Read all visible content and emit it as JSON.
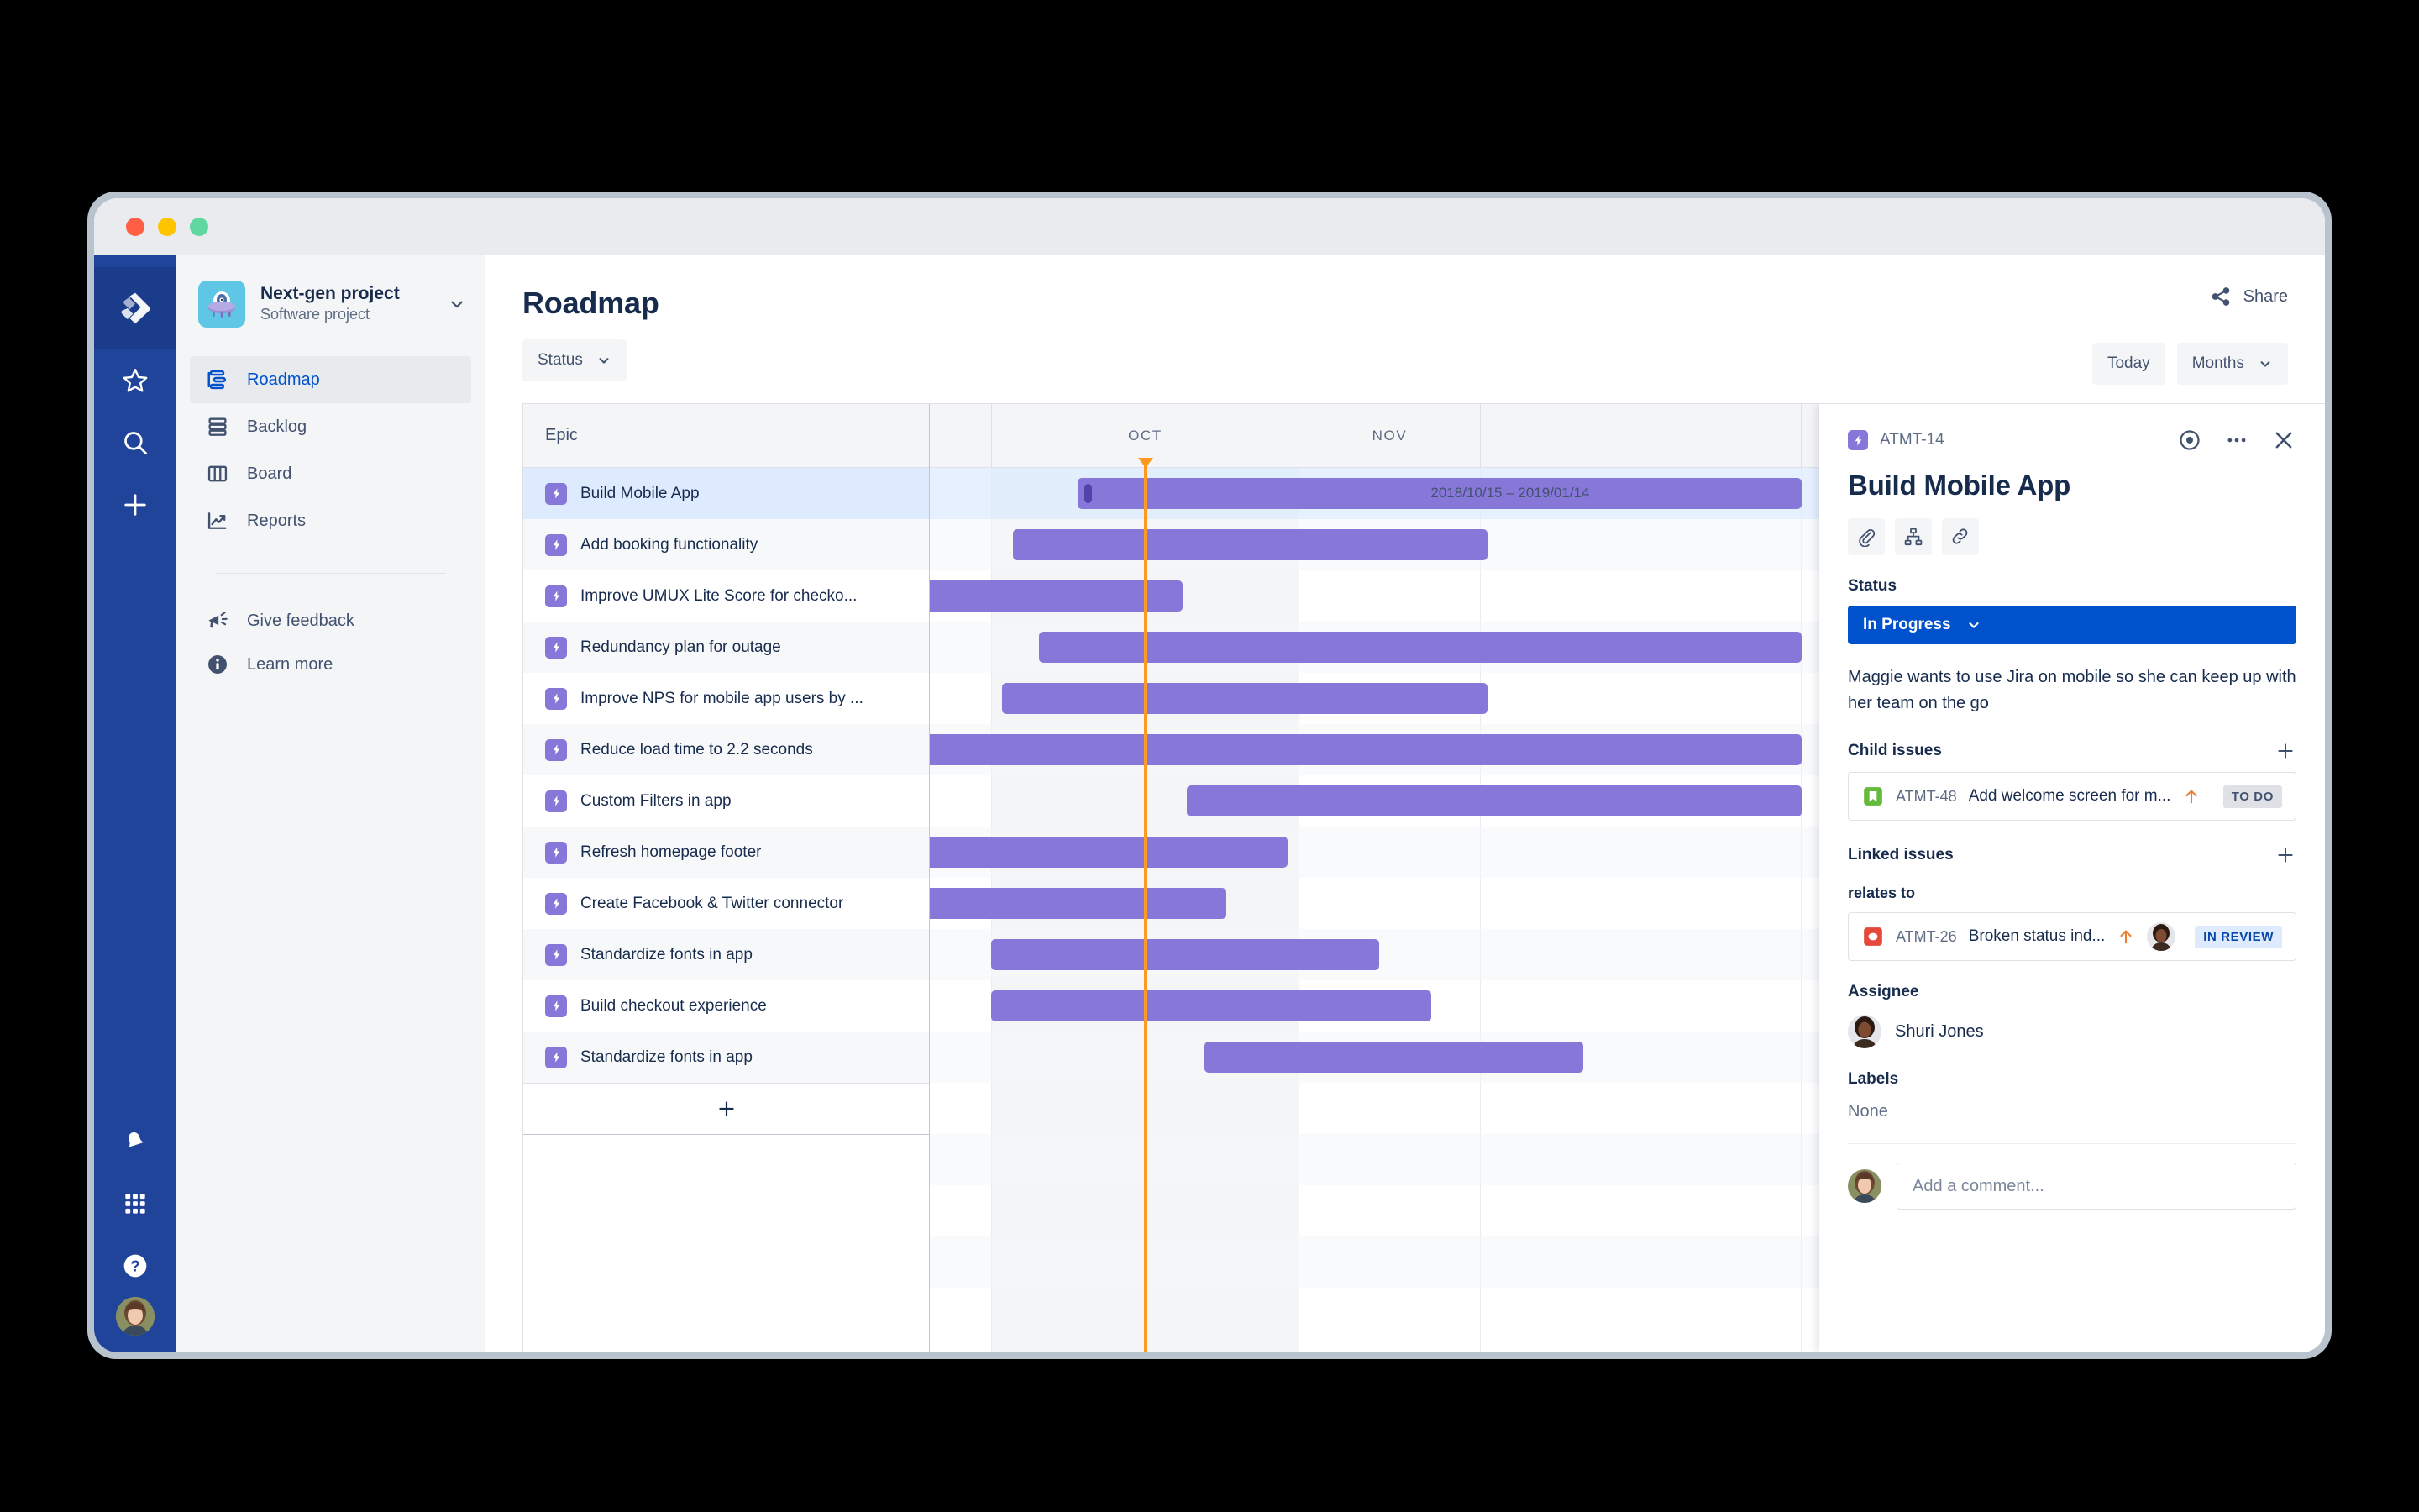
{
  "window": {
    "traffic_lights": [
      "close",
      "minimize",
      "maximize"
    ]
  },
  "rail": {
    "logo_icon": "jira-logo-icon",
    "items": [
      {
        "name": "starred",
        "icon": "star-icon"
      },
      {
        "name": "search",
        "icon": "search-icon"
      },
      {
        "name": "create",
        "icon": "plus-icon"
      }
    ],
    "bottom_items": [
      {
        "name": "notifications",
        "icon": "bell-icon"
      },
      {
        "name": "app-switcher",
        "icon": "grid-icon"
      },
      {
        "name": "help",
        "icon": "question-circle-icon"
      }
    ],
    "avatar": "user-avatar"
  },
  "sidebar": {
    "project": {
      "name": "Next-gen project",
      "type": "Software project",
      "avatar_icon": "ufo-project-icon",
      "caret_icon": "chevron-down-icon"
    },
    "items": [
      {
        "label": "Roadmap",
        "icon": "roadmap-icon",
        "active": true
      },
      {
        "label": "Backlog",
        "icon": "backlog-icon",
        "active": false
      },
      {
        "label": "Board",
        "icon": "board-icon",
        "active": false
      },
      {
        "label": "Reports",
        "icon": "reports-icon",
        "active": false
      }
    ],
    "footer_items": [
      {
        "label": "Give feedback",
        "icon": "megaphone-icon"
      },
      {
        "label": "Learn more",
        "icon": "info-icon"
      }
    ]
  },
  "header": {
    "title": "Roadmap",
    "status_filter": "Status",
    "status_filter_icon": "chevron-down-icon",
    "share_label": "Share",
    "share_icon": "share-icon",
    "today_label": "Today",
    "zoom_label": "Months",
    "zoom_icon": "chevron-down-icon"
  },
  "roadmap": {
    "column_header": "Epic",
    "add_epic_icon": "plus-icon",
    "months": [
      "",
      "OCT",
      "NOV",
      ""
    ],
    "today_marker": true,
    "selected_row_index": 0,
    "selected_bar_label": "2018/10/15 – 2019/01/14",
    "epics": [
      {
        "name": "Build Mobile App",
        "icon": "epic-icon"
      },
      {
        "name": "Add booking functionality",
        "icon": "epic-icon"
      },
      {
        "name": "Improve UMUX Lite Score for checko...",
        "icon": "epic-icon"
      },
      {
        "name": "Redundancy plan for outage",
        "icon": "epic-icon"
      },
      {
        "name": "Improve NPS for mobile app users by ...",
        "icon": "epic-icon"
      },
      {
        "name": "Reduce load time to 2.2 seconds",
        "icon": "epic-icon"
      },
      {
        "name": "Custom Filters in app",
        "icon": "epic-icon"
      },
      {
        "name": "Refresh homepage footer",
        "icon": "epic-icon"
      },
      {
        "name": "Create Facebook & Twitter connector",
        "icon": "epic-icon"
      },
      {
        "name": "Standardize fonts in app",
        "icon": "epic-icon"
      },
      {
        "name": "Build checkout experience",
        "icon": "epic-icon"
      },
      {
        "name": "Standardize fonts in app",
        "icon": "epic-icon"
      }
    ]
  },
  "chart_data": {
    "type": "bar",
    "title": "Roadmap",
    "xlabel": "",
    "ylabel": "",
    "grid": true,
    "legend": "none",
    "x_axis_ticks": [
      "OCT",
      "NOV"
    ],
    "x_range_pct": [
      0,
      100
    ],
    "today_pct": 24.6,
    "categories": [
      "Build Mobile App",
      "Add booking functionality",
      "Improve UMUX Lite Score for checko...",
      "Redundancy plan for outage",
      "Improve NPS for mobile app users by ...",
      "Reduce load time to 2.2 seconds",
      "Custom Filters in app",
      "Refresh homepage footer",
      "Create Facebook & Twitter connector",
      "Standardize fonts in app",
      "Build checkout experience",
      "Standardize fonts in app"
    ],
    "bars": [
      {
        "label": "Build Mobile App",
        "start_pct": 17.0,
        "end_pct": 100.0,
        "dates": "2018/10/15 – 2019/01/14",
        "handle": true
      },
      {
        "label": "Add booking functionality",
        "start_pct": 9.5,
        "end_pct": 64.0,
        "dates": "",
        "handle": false
      },
      {
        "label": "Improve UMUX Lite Score for checko...",
        "start_pct": -2.0,
        "end_pct": 29.0,
        "dates": "",
        "handle": false
      },
      {
        "label": "Redundancy plan for outage",
        "start_pct": 12.5,
        "end_pct": 100.0,
        "dates": "",
        "handle": false
      },
      {
        "label": "Improve NPS for mobile app users by ...",
        "start_pct": 8.3,
        "end_pct": 64.0,
        "dates": "",
        "handle": false
      },
      {
        "label": "Reduce load time to 2.2 seconds",
        "start_pct": -2.0,
        "end_pct": 100.0,
        "dates": "",
        "handle": false
      },
      {
        "label": "Custom Filters in app",
        "start_pct": 29.5,
        "end_pct": 100.0,
        "dates": "",
        "handle": false
      },
      {
        "label": "Refresh homepage footer",
        "start_pct": -2.0,
        "end_pct": 41.0,
        "dates": "",
        "handle": false
      },
      {
        "label": "Create Facebook & Twitter connector",
        "start_pct": -2.0,
        "end_pct": 34.0,
        "dates": "",
        "handle": false
      },
      {
        "label": "Standardize fonts in app",
        "start_pct": 7.0,
        "end_pct": 51.5,
        "dates": "",
        "handle": false
      },
      {
        "label": "Build checkout experience",
        "start_pct": 7.0,
        "end_pct": 57.5,
        "dates": "",
        "handle": false
      },
      {
        "label": "Standardize fonts in app",
        "start_pct": 31.5,
        "end_pct": 75.0,
        "dates": "",
        "handle": false
      }
    ],
    "bar_color": "#8777d9",
    "today_color": "#ff991f"
  },
  "detail": {
    "issue_key": "ATMT-14",
    "key_icon": "epic-icon",
    "watch_icon": "eye-icon",
    "more_icon": "more-horizontal-icon",
    "close_icon": "close-icon",
    "title": "Build Mobile App",
    "action_icons": [
      "attach-icon",
      "child-issue-icon",
      "link-icon"
    ],
    "status_label": "Status",
    "status_value": "In Progress",
    "status_caret_icon": "chevron-down-icon",
    "description": "Maggie wants to use Jira on mobile so she can keep up with her team on the go",
    "child_issues_label": "Child issues",
    "child_add_icon": "plus-icon",
    "child_issues": [
      {
        "key": "ATMT-48",
        "summary": "Add welcome screen for m...",
        "type_icon": "story-icon",
        "priority_icon": "priority-high-icon",
        "status": "TO DO",
        "status_style": "todo",
        "avatar": false
      }
    ],
    "linked_issues_label": "Linked issues",
    "linked_add_icon": "plus-icon",
    "relation_label": "relates to",
    "linked_issues": [
      {
        "key": "ATMT-26",
        "summary": "Broken status ind...",
        "type_icon": "bug-icon",
        "priority_icon": "priority-high-icon",
        "status": "IN REVIEW",
        "status_style": "review",
        "avatar": true
      }
    ],
    "assignee_label": "Assignee",
    "assignee_name": "Shuri Jones",
    "labels_label": "Labels",
    "labels_value": "None",
    "comment_placeholder": "Add a comment..."
  },
  "colors": {
    "brand_blue": "#21449b",
    "accent_blue": "#0052cc",
    "epic_purple": "#8777d9",
    "today_orange": "#ff991f",
    "bug_red": "#e5493a",
    "story_green": "#64ba3b"
  }
}
